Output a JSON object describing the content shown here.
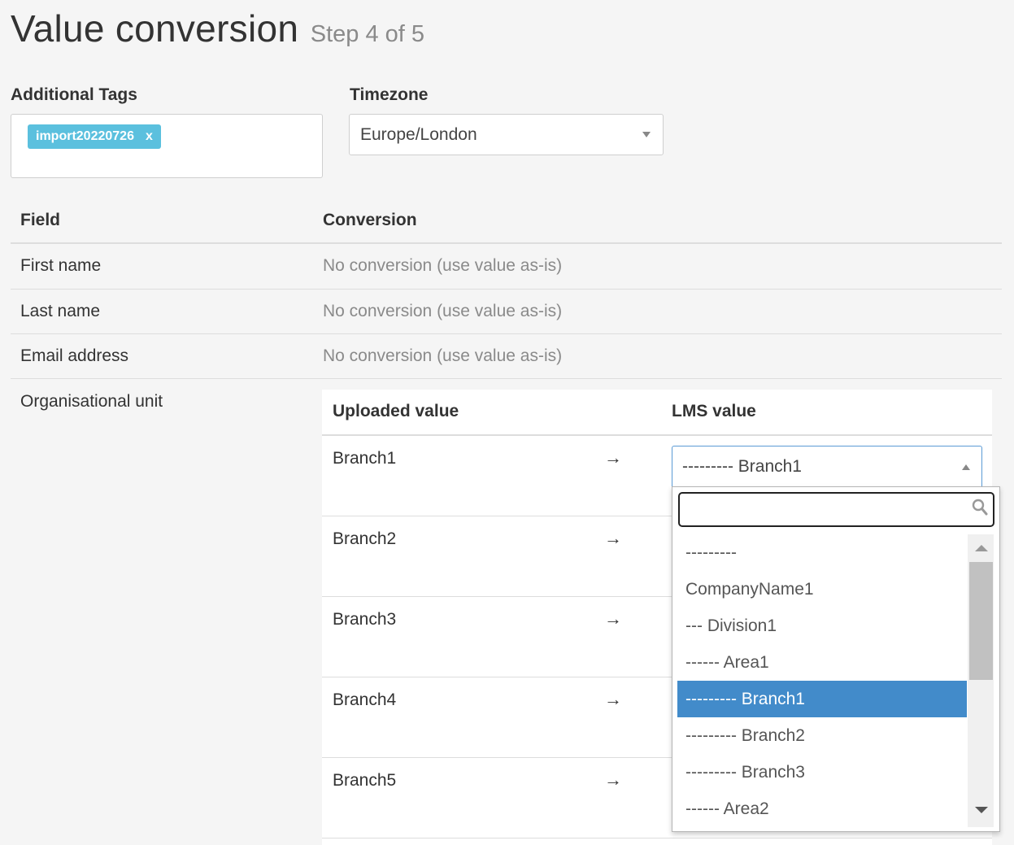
{
  "page": {
    "title": "Value conversion",
    "step": "Step 4 of 5"
  },
  "additional_tags": {
    "label": "Additional Tags",
    "tags": [
      {
        "text": "import20220726",
        "remove": "x"
      }
    ]
  },
  "timezone": {
    "label": "Timezone",
    "value": "Europe/London"
  },
  "table": {
    "headers": {
      "field": "Field",
      "conversion": "Conversion"
    },
    "rows": [
      {
        "field": "First name",
        "conversion": "No conversion (use value as-is)"
      },
      {
        "field": "Last name",
        "conversion": "No conversion (use value as-is)"
      },
      {
        "field": "Email address",
        "conversion": "No conversion (use value as-is)"
      },
      {
        "field": "Organisational unit",
        "conversion": ""
      }
    ]
  },
  "mapping": {
    "headers": {
      "uploaded": "Uploaded value",
      "lms": "LMS value"
    },
    "arrow": "→",
    "rows": [
      {
        "uploaded": "Branch1"
      },
      {
        "uploaded": "Branch2"
      },
      {
        "uploaded": "Branch3"
      },
      {
        "uploaded": "Branch4"
      },
      {
        "uploaded": "Branch5"
      }
    ],
    "selected_lms_value": "--------- Branch1"
  },
  "dropdown": {
    "search_value": "",
    "options": [
      "---------",
      "CompanyName1",
      "--- Division1",
      "------ Area1",
      "--------- Branch1",
      "--------- Branch2",
      "--------- Branch3",
      "------ Area2"
    ],
    "selected_index": 4,
    "highlight_color": "#428bca"
  }
}
